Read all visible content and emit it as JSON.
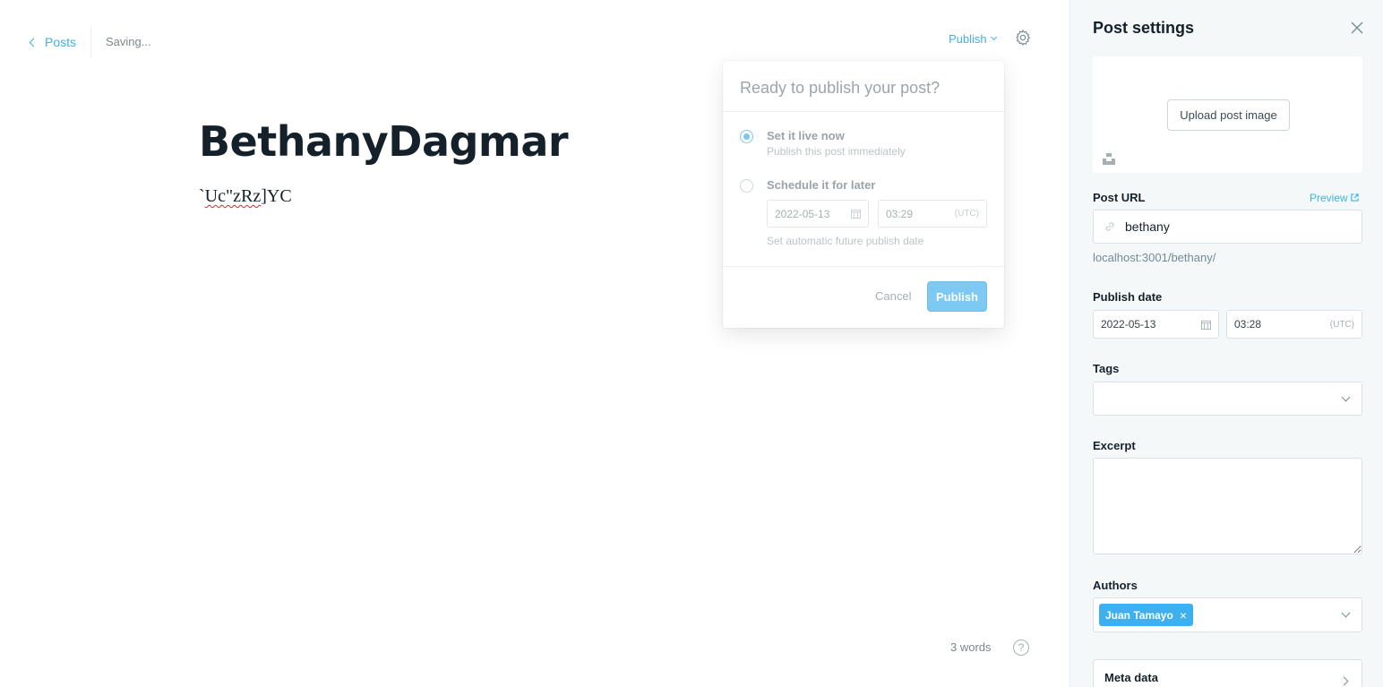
{
  "header": {
    "back_label": "Posts",
    "status": "Saving...",
    "publish_menu_label": "Publish"
  },
  "post": {
    "title": "BethanyDagmar",
    "body_prefix": "`",
    "body_typo": "Uc\"zRz",
    "body_suffix": "]YC"
  },
  "footer": {
    "word_count": "3 words",
    "help_label": "?"
  },
  "publish_popover": {
    "heading": "Ready to publish your post?",
    "option_now_title": "Set it live now",
    "option_now_sub": "Publish this post immediately",
    "option_later_title": "Schedule it for later",
    "schedule_date": "2022-05-13",
    "schedule_time": "03:29",
    "schedule_tz": "(UTC)",
    "schedule_help": "Set automatic future publish date",
    "cancel_label": "Cancel",
    "publish_label": "Publish",
    "selected_option": "now"
  },
  "settings": {
    "title": "Post settings",
    "upload_label": "Upload post image",
    "url_label": "Post URL",
    "preview_label": "Preview",
    "slug": "bethany",
    "url_hint": "localhost:3001/bethany/",
    "publish_date_label": "Publish date",
    "publish_date": "2022-05-13",
    "publish_time": "03:28",
    "publish_tz": "(UTC)",
    "tags_label": "Tags",
    "excerpt_label": "Excerpt",
    "authors_label": "Authors",
    "author_chip": "Juan Tamayo",
    "author_remove": "×",
    "meta_label": "Meta data"
  },
  "colors": {
    "accent": "#3eb0ef",
    "text": "#15212a",
    "sidebar_bg": "#f5f8f9"
  },
  "icons": [
    "chevron-left-icon",
    "chevron-down-icon",
    "gear-icon",
    "help-icon",
    "close-icon",
    "calendar-icon",
    "link-icon",
    "external-link-icon",
    "unsplash-icon",
    "chevron-right-icon"
  ]
}
